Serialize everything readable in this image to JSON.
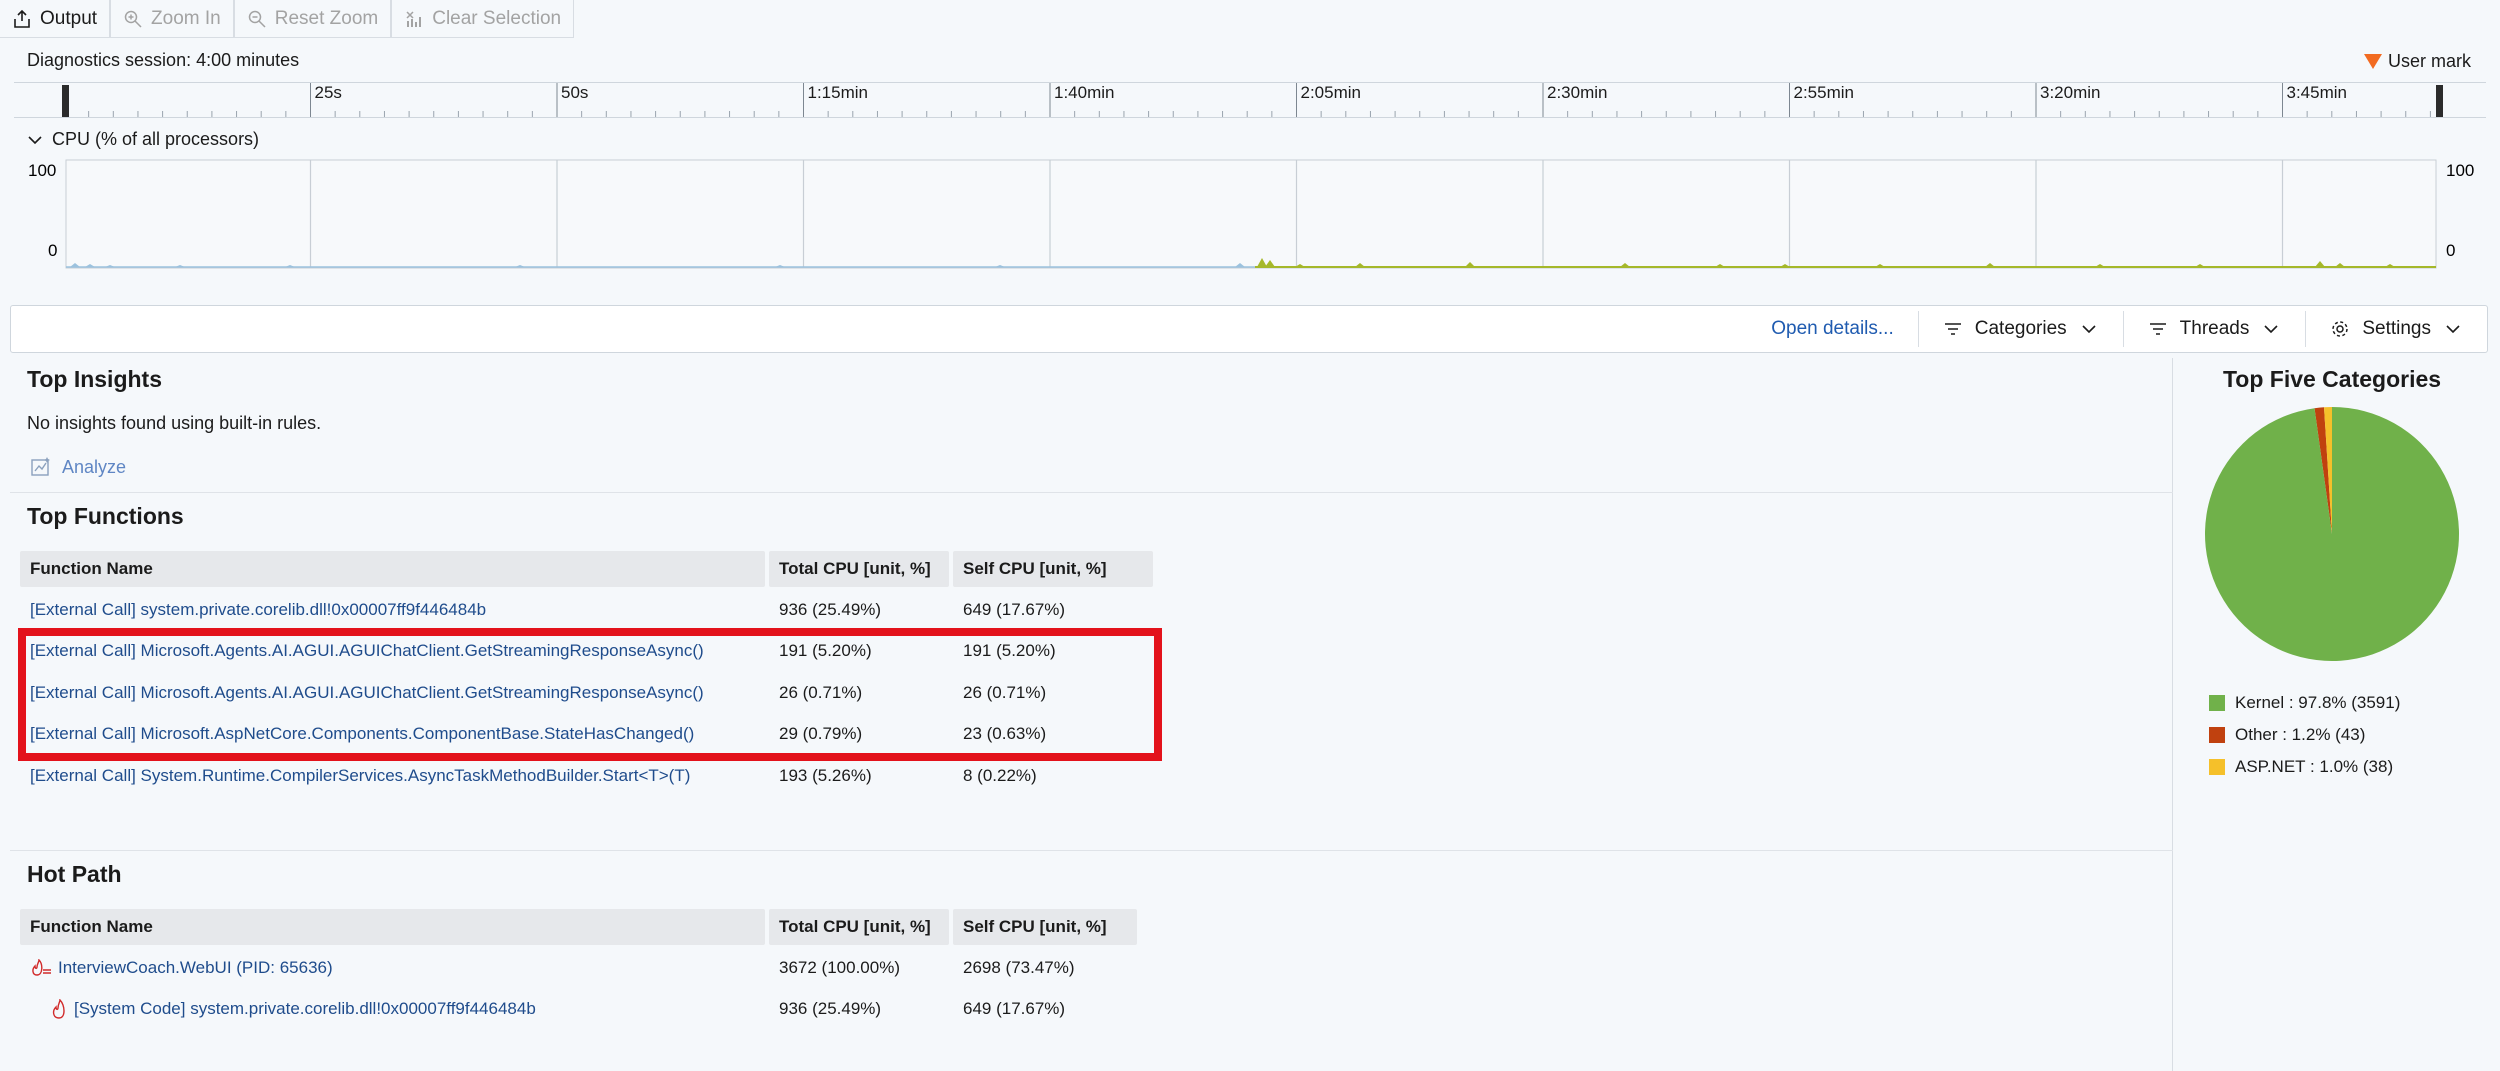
{
  "toolbar": {
    "output": "Output",
    "zoom_in": "Zoom In",
    "reset_zoom": "Reset Zoom",
    "clear_selection": "Clear Selection"
  },
  "session": "Diagnostics session: 4:00 minutes",
  "user_mark": "User mark",
  "ruler_ticks": [
    "25s",
    "50s",
    "1:15min",
    "1:40min",
    "2:05min",
    "2:30min",
    "2:55min",
    "3:20min",
    "3:45min"
  ],
  "cpu": {
    "label": "CPU (% of all processors)",
    "y_max": "100",
    "y_min": "0"
  },
  "filters": {
    "open_details": "Open details...",
    "categories": "Categories",
    "threads": "Threads",
    "settings": "Settings"
  },
  "insights": {
    "title": "Top Insights",
    "message": "No insights found using built-in rules.",
    "analyze": "Analyze"
  },
  "top_functions": {
    "title": "Top Functions",
    "headers": [
      "Function Name",
      "Total CPU [unit, %]",
      "Self CPU [unit, %]"
    ],
    "rows": [
      [
        "[External Call] system.private.corelib.dll!0x00007ff9f446484b",
        "936 (25.49%)",
        "649 (17.67%)"
      ],
      [
        "[External Call] Microsoft.Agents.AI.AGUI.AGUIChatClient.GetStreamingResponseAsync()",
        "191 (5.20%)",
        "191 (5.20%)"
      ],
      [
        "[External Call] Microsoft.Agents.AI.AGUI.AGUIChatClient.GetStreamingResponseAsync()",
        "26 (0.71%)",
        "26 (0.71%)"
      ],
      [
        "[External Call] Microsoft.AspNetCore.Components.ComponentBase.StateHasChanged()",
        "29 (0.79%)",
        "23 (0.63%)"
      ],
      [
        "[External Call] System.Runtime.CompilerServices.AsyncTaskMethodBuilder.Start<T>(T)",
        "193 (5.26%)",
        "8 (0.22%)"
      ]
    ]
  },
  "hot_path": {
    "title": "Hot Path",
    "headers": [
      "Function Name",
      "Total CPU [unit, %]",
      "Self CPU [unit, %]"
    ],
    "rows": [
      [
        "InterviewCoach.WebUI (PID: 65636)",
        "3672 (100.00%)",
        "2698 (73.47%)"
      ],
      [
        "[System Code] system.private.corelib.dll!0x00007ff9f446484b",
        "936 (25.49%)",
        "649 (17.67%)"
      ]
    ]
  },
  "categories_panel": {
    "title": "Top Five Categories",
    "slices": [
      {
        "name": "Kernel",
        "label": "Kernel : 97.8% (3591)",
        "value": 97.8,
        "color": "#70b14a"
      },
      {
        "name": "Other",
        "label": "Other : 1.2% (43)",
        "value": 1.2,
        "color": "#c0410f"
      },
      {
        "name": "ASP.NET",
        "label": "ASP.NET : 1.0% (38)",
        "value": 1.0,
        "color": "#f5c02a"
      }
    ]
  }
}
